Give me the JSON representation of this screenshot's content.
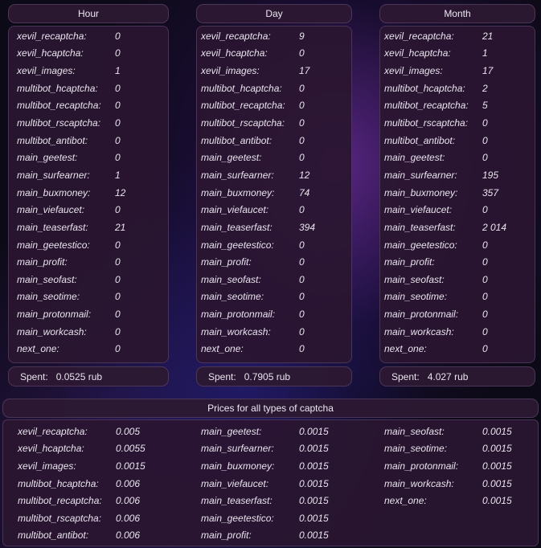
{
  "stats": [
    {
      "title": "Hour",
      "spent_label": "Spent:",
      "spent_value": "0.0525 rub",
      "rows": [
        {
          "k": "xevil_recaptcha:",
          "v": "0"
        },
        {
          "k": "xevil_hcaptcha:",
          "v": "0"
        },
        {
          "k": "xevil_images:",
          "v": "1"
        },
        {
          "k": "multibot_hcaptcha:",
          "v": "0"
        },
        {
          "k": "multibot_recaptcha:",
          "v": "0"
        },
        {
          "k": "multibot_rscaptcha:",
          "v": "0"
        },
        {
          "k": "multibot_antibot:",
          "v": "0"
        },
        {
          "k": "main_geetest:",
          "v": "0"
        },
        {
          "k": "main_surfearner:",
          "v": "1"
        },
        {
          "k": "main_buxmoney:",
          "v": "12"
        },
        {
          "k": "main_viefaucet:",
          "v": "0"
        },
        {
          "k": "main_teaserfast:",
          "v": "21"
        },
        {
          "k": "main_geetestico:",
          "v": "0"
        },
        {
          "k": "main_profit:",
          "v": "0"
        },
        {
          "k": "main_seofast:",
          "v": "0"
        },
        {
          "k": "main_seotime:",
          "v": "0"
        },
        {
          "k": "main_protonmail:",
          "v": "0"
        },
        {
          "k": "main_workcash:",
          "v": "0"
        },
        {
          "k": "next_one:",
          "v": "0"
        }
      ]
    },
    {
      "title": "Day",
      "spent_label": "Spent:",
      "spent_value": "0.7905 rub",
      "rows": [
        {
          "k": "xevil_recaptcha:",
          "v": "9"
        },
        {
          "k": "xevil_hcaptcha:",
          "v": "0"
        },
        {
          "k": "xevil_images:",
          "v": "17"
        },
        {
          "k": "multibot_hcaptcha:",
          "v": "0"
        },
        {
          "k": "multibot_recaptcha:",
          "v": "0"
        },
        {
          "k": "multibot_rscaptcha:",
          "v": "0"
        },
        {
          "k": "multibot_antibot:",
          "v": "0"
        },
        {
          "k": "main_geetest:",
          "v": "0"
        },
        {
          "k": "main_surfearner:",
          "v": "12"
        },
        {
          "k": "main_buxmoney:",
          "v": "74"
        },
        {
          "k": "main_viefaucet:",
          "v": "0"
        },
        {
          "k": "main_teaserfast:",
          "v": "394"
        },
        {
          "k": "main_geetestico:",
          "v": "0"
        },
        {
          "k": "main_profit:",
          "v": "0"
        },
        {
          "k": "main_seofast:",
          "v": "0"
        },
        {
          "k": "main_seotime:",
          "v": "0"
        },
        {
          "k": "main_protonmail:",
          "v": "0"
        },
        {
          "k": "main_workcash:",
          "v": "0"
        },
        {
          "k": "next_one:",
          "v": "0"
        }
      ]
    },
    {
      "title": "Month",
      "spent_label": "Spent:",
      "spent_value": "4.027 rub",
      "rows": [
        {
          "k": "xevil_recaptcha:",
          "v": "21"
        },
        {
          "k": "xevil_hcaptcha:",
          "v": "1"
        },
        {
          "k": "xevil_images:",
          "v": "17"
        },
        {
          "k": "multibot_hcaptcha:",
          "v": "2"
        },
        {
          "k": "multibot_recaptcha:",
          "v": "5"
        },
        {
          "k": "multibot_rscaptcha:",
          "v": "0"
        },
        {
          "k": "multibot_antibot:",
          "v": "0"
        },
        {
          "k": "main_geetest:",
          "v": "0"
        },
        {
          "k": "main_surfearner:",
          "v": "195"
        },
        {
          "k": "main_buxmoney:",
          "v": "357"
        },
        {
          "k": "main_viefaucet:",
          "v": "0"
        },
        {
          "k": "main_teaserfast:",
          "v": "2 014"
        },
        {
          "k": "main_geetestico:",
          "v": "0"
        },
        {
          "k": "main_profit:",
          "v": "0"
        },
        {
          "k": "main_seofast:",
          "v": "0"
        },
        {
          "k": "main_seotime:",
          "v": "0"
        },
        {
          "k": "main_protonmail:",
          "v": "0"
        },
        {
          "k": "main_workcash:",
          "v": "0"
        },
        {
          "k": "next_one:",
          "v": "0"
        }
      ]
    }
  ],
  "prices": {
    "title": "Prices for all types of captcha",
    "columns": [
      [
        {
          "k": "xevil_recaptcha:",
          "v": "0.005"
        },
        {
          "k": "xevil_hcaptcha:",
          "v": "0.0055"
        },
        {
          "k": "xevil_images:",
          "v": "0.0015"
        },
        {
          "k": "multibot_hcaptcha:",
          "v": "0.006"
        },
        {
          "k": "multibot_recaptcha:",
          "v": "0.006"
        },
        {
          "k": "multibot_rscaptcha:",
          "v": "0.006"
        },
        {
          "k": "multibot_antibot:",
          "v": "0.006"
        }
      ],
      [
        {
          "k": "main_geetest:",
          "v": "0.0015"
        },
        {
          "k": "main_surfearner:",
          "v": "0.0015"
        },
        {
          "k": "main_buxmoney:",
          "v": "0.0015"
        },
        {
          "k": "main_viefaucet:",
          "v": "0.0015"
        },
        {
          "k": "main_teaserfast:",
          "v": "0.0015"
        },
        {
          "k": "main_geetestico:",
          "v": "0.0015"
        },
        {
          "k": "main_profit:",
          "v": "0.0015"
        }
      ],
      [
        {
          "k": "main_seofast:",
          "v": "0.0015"
        },
        {
          "k": "main_seotime:",
          "v": "0.0015"
        },
        {
          "k": "main_protonmail:",
          "v": "0.0015"
        },
        {
          "k": "main_workcash:",
          "v": "0.0015"
        },
        {
          "k": "next_one:",
          "v": "0.0015"
        }
      ]
    ]
  }
}
